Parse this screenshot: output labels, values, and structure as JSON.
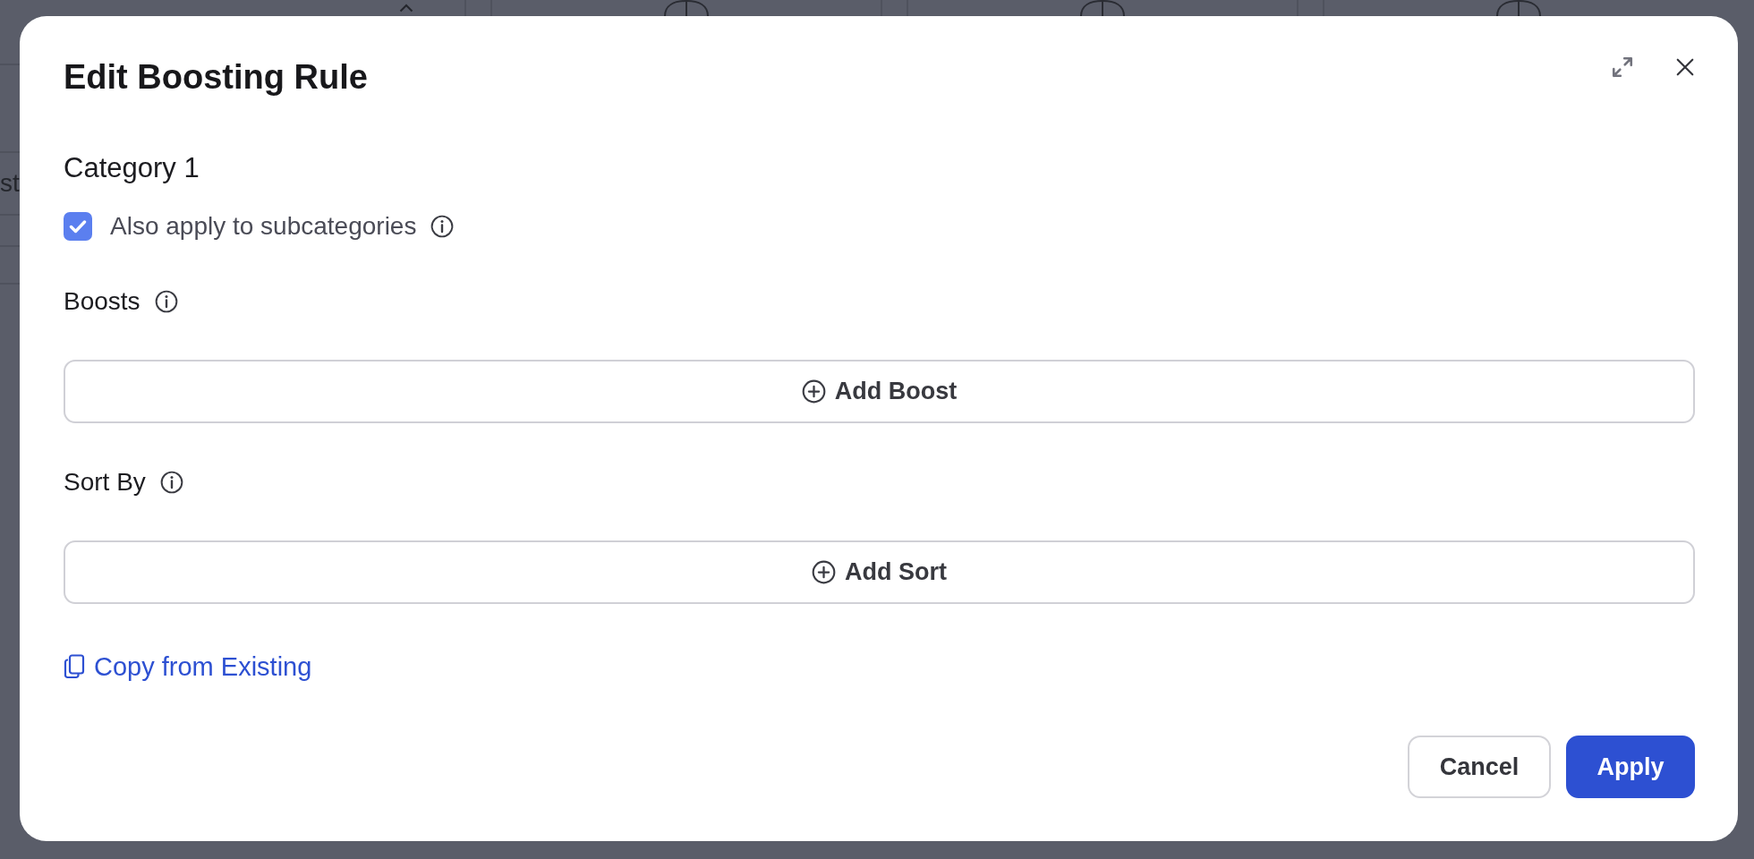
{
  "background": {
    "cut_text": "st"
  },
  "dialog": {
    "title": "Edit Boosting Rule",
    "category": "Category 1",
    "subcategories_option": {
      "label": "Also apply to subcategories",
      "checked": true
    },
    "sections": [
      {
        "label": "Boosts",
        "button": "Add Boost"
      },
      {
        "label": "Sort By",
        "button": "Add Sort"
      }
    ],
    "copy_link": "Copy from Existing",
    "buttons": [
      {
        "label": "Cancel",
        "kind": "secondary"
      },
      {
        "label": "Apply",
        "kind": "primary"
      }
    ]
  }
}
